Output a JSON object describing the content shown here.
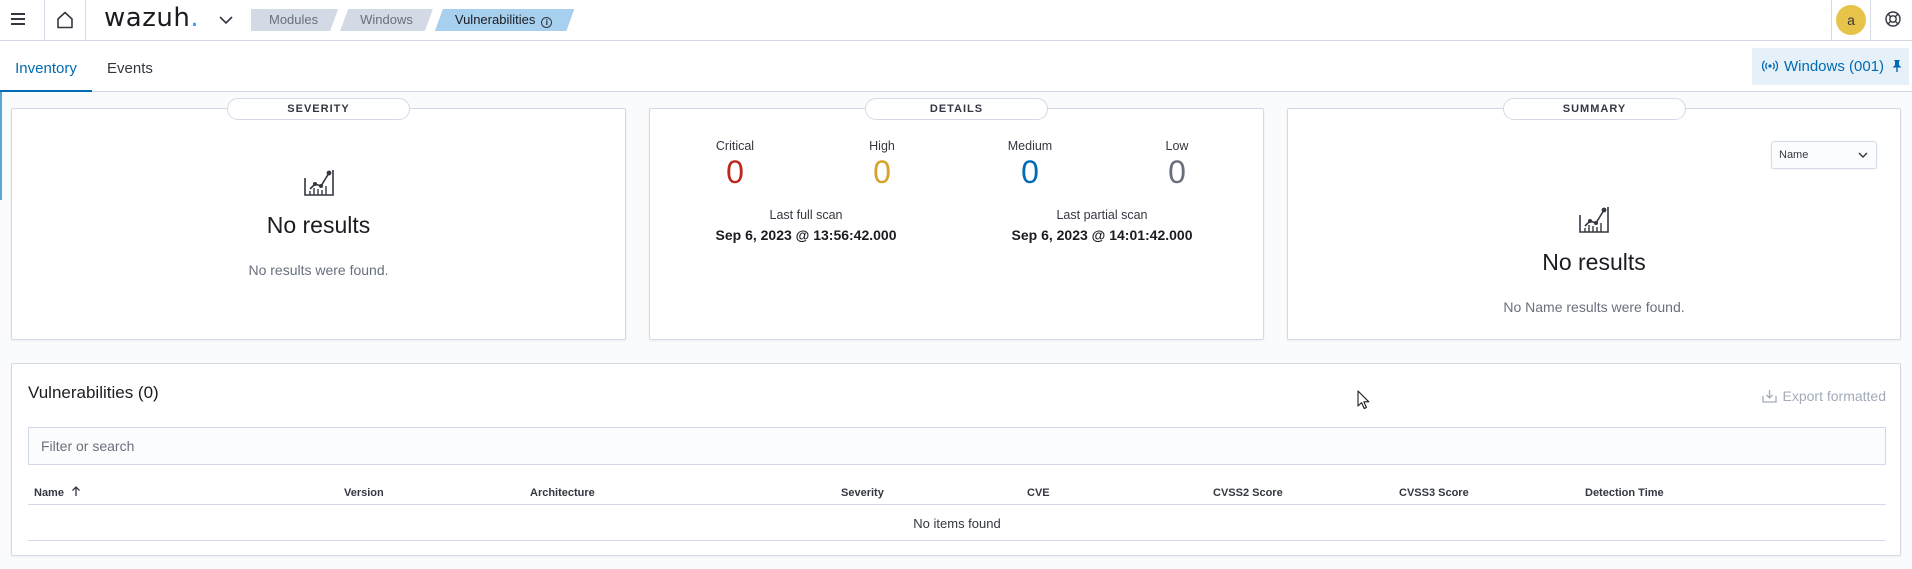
{
  "header": {
    "logo_text": "wazuh",
    "logo_dot": ".",
    "breadcrumbs": [
      "Modules",
      "Windows",
      "Vulnerabilities"
    ],
    "avatar_letter": "a"
  },
  "tabs": [
    {
      "label": "Inventory",
      "active": true
    },
    {
      "label": "Events",
      "active": false
    }
  ],
  "agent_button": {
    "label": "Windows (001)"
  },
  "severity_panel": {
    "title": "SEVERITY",
    "empty_title": "No results",
    "empty_text": "No results were found."
  },
  "details_panel": {
    "title": "DETAILS",
    "counts": [
      {
        "label": "Critical",
        "value": "0",
        "color": "#bd271e"
      },
      {
        "label": "High",
        "value": "0",
        "color": "#d6a22c"
      },
      {
        "label": "Medium",
        "value": "0",
        "color": "#006bb4"
      },
      {
        "label": "Low",
        "value": "0",
        "color": "#69707d"
      }
    ],
    "last_full_scan_label": "Last full scan",
    "last_full_scan_value": "Sep 6, 2023 @ 13:56:42.000",
    "last_partial_scan_label": "Last partial scan",
    "last_partial_scan_value": "Sep 6, 2023 @ 14:01:42.000"
  },
  "summary_panel": {
    "title": "SUMMARY",
    "select_value": "Name",
    "empty_title": "No results",
    "empty_text": "No Name results were found."
  },
  "vulnerabilities": {
    "title": "Vulnerabilities (0)",
    "export_label": "Export formatted",
    "search_placeholder": "Filter or search",
    "columns": [
      "Name",
      "Version",
      "Architecture",
      "Severity",
      "CVE",
      "CVSS2 Score",
      "CVSS3 Score",
      "Detection Time"
    ],
    "empty_message": "No items found"
  },
  "colors": {
    "accent": "#006bb4",
    "breadcrumb_active": "#a7d0ee",
    "avatar": "#e7c34a"
  }
}
